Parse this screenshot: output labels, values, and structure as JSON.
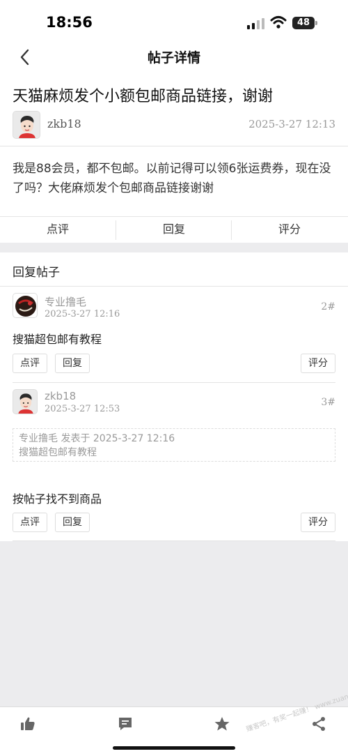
{
  "status": {
    "time": "18:56",
    "battery": "48"
  },
  "nav": {
    "title": "帖子详情"
  },
  "post": {
    "title": "天猫麻烦发个小额包邮商品链接，谢谢",
    "author": "zkb18",
    "time": "2025-3-27 12:13",
    "body": "我是88会员，都不包邮。以前记得可以领6张运费券，现在没了吗？大佬麻烦发个包邮商品链接谢谢"
  },
  "actions": {
    "comment": "点评",
    "reply": "回复",
    "rate": "评分"
  },
  "replies": {
    "title": "回复帖子",
    "items": [
      {
        "author": "专业撸毛",
        "time": "2025-3-27 12:16",
        "floor": "2#",
        "text": "搜猫超包邮有教程",
        "comment": "点评",
        "reply": "回复",
        "rate": "评分"
      },
      {
        "author": "zkb18",
        "time": "2025-3-27 12:53",
        "floor": "3#",
        "quote_header": "专业撸毛 发表于 2025-3-27 12:16",
        "quote_text": "搜猫超包邮有教程",
        "text": "按帖子找不到商品",
        "comment": "点评",
        "reply": "回复",
        "rate": "评分"
      }
    ]
  },
  "tabbar": {
    "icons": [
      "thumbs-up-icon",
      "comment-icon",
      "star-icon",
      "share-icon"
    ]
  },
  "watermark": "赚客吧，有奖一起赚！ www.zuanke8.com",
  "colors": {
    "background": "#ececee",
    "icon": "#666666",
    "muted": "#999999"
  }
}
